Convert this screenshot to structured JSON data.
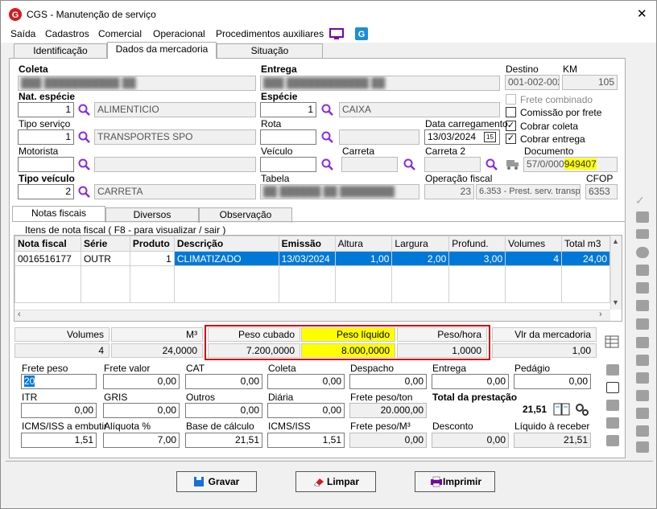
{
  "window": {
    "title": "CGS - Manutenção de serviço",
    "close": "✕"
  },
  "menu": [
    "Saída",
    "Cadastros",
    "Comercial",
    "Operacional",
    "Procedimentos auxiliares"
  ],
  "tabs": [
    "Identificação",
    "Dados da mercadoria",
    "Situação"
  ],
  "coleta": {
    "label": "Coleta"
  },
  "entrega": {
    "label": "Entrega"
  },
  "destino": {
    "label": "Destino",
    "value": "001-002-002"
  },
  "km": {
    "label": "KM",
    "value": "105"
  },
  "nat_especie": {
    "label": "Nat. espécie",
    "code": "1",
    "name": "ALIMENTICIO"
  },
  "especie": {
    "label": "Espécie",
    "code": "1",
    "name": "CAIXA"
  },
  "tipo_servico": {
    "label": "Tipo serviço",
    "code": "1",
    "name": "TRANSPORTES SPO"
  },
  "rota": {
    "label": "Rota"
  },
  "data_carregamento": {
    "label": "Data carregamento",
    "value": "13/03/2024",
    "cal": "15"
  },
  "motorista": {
    "label": "Motorista"
  },
  "veiculo": {
    "label": "Veículo"
  },
  "carreta": {
    "label": "Carreta"
  },
  "carreta2": {
    "label": "Carreta 2"
  },
  "documento": {
    "label": "Documento",
    "prefix": "57/0/000",
    "highlight": "949407"
  },
  "tipo_veiculo": {
    "label": "Tipo veículo",
    "code": "2",
    "name": "CARRETA"
  },
  "tabela": {
    "label": "Tabela"
  },
  "operacao_fiscal": {
    "label": "Operação fiscal",
    "code": "23",
    "name": "6.353 - Prest. serv. transp."
  },
  "cfop": {
    "label": "CFOP",
    "value": "6353"
  },
  "checks": {
    "frete_combinado": "Frete combinado",
    "comissao": "Comissão por frete",
    "cobrar_coleta": "Cobrar coleta",
    "cobrar_entrega": "Cobrar entrega"
  },
  "subtabs": [
    "Notas fiscais",
    "Diversos",
    "Observação"
  ],
  "nf_group": "Itens de nota fiscal ( F8 - para visualizar / sair )",
  "grid": {
    "headers": [
      "Nota fiscal",
      "Série",
      "Produto",
      "Descrição",
      "Emissão",
      "Altura",
      "Largura",
      "Profund.",
      "Volumes",
      "Total m3"
    ],
    "row": [
      "0016516177",
      "OUTR",
      "1",
      "CLIMATIZADO",
      "13/03/2024",
      "1,00",
      "2,00",
      "3,00",
      "4",
      "24,00"
    ]
  },
  "totals": {
    "headers": [
      "Volumes",
      "M³",
      "Peso cubado",
      "Peso líquido",
      "Peso/hora",
      "Vlr da mercadoria"
    ],
    "values": [
      "4",
      "24,0000",
      "7.200,0000",
      "8.000,0000",
      "1,0000",
      "1,00"
    ]
  },
  "frete": {
    "row1": [
      {
        "label": "Frete peso",
        "value": "20"
      },
      {
        "label": "Frete valor",
        "value": "0,00"
      },
      {
        "label": "CAT",
        "value": "0,00"
      },
      {
        "label": "Coleta",
        "value": "0,00"
      },
      {
        "label": "Despacho",
        "value": "0,00"
      },
      {
        "label": "Entrega",
        "value": "0,00"
      },
      {
        "label": "Pedágio",
        "value": "0,00"
      }
    ],
    "row2": [
      {
        "label": "ITR",
        "value": "0,00"
      },
      {
        "label": "GRIS",
        "value": "0,00"
      },
      {
        "label": "Outros",
        "value": "0,00"
      },
      {
        "label": "Diária",
        "value": "0,00"
      },
      {
        "label": "Frete peso/ton",
        "value": "20.000,00"
      },
      {
        "label": "Total da prestação",
        "value": "21,51"
      }
    ],
    "row3": [
      {
        "label": "ICMS/ISS a embutir",
        "value": "1,51"
      },
      {
        "label": "Alíquota %",
        "value": "7,00"
      },
      {
        "label": "Base de cálculo",
        "value": "21,51"
      },
      {
        "label": "ICMS/ISS",
        "value": "1,51"
      },
      {
        "label": "Frete peso/M³",
        "value": "0,00"
      },
      {
        "label": "Desconto",
        "value": "0,00"
      },
      {
        "label": "Líquido à receber",
        "value": "21,51"
      }
    ]
  },
  "buttons": {
    "gravar": "Gravar",
    "limpar": "Limpar",
    "imprimir": "Imprimir"
  },
  "colors": {
    "accent": "#cc0000",
    "highlight": "#ffff00",
    "selection": "#0078d7"
  }
}
